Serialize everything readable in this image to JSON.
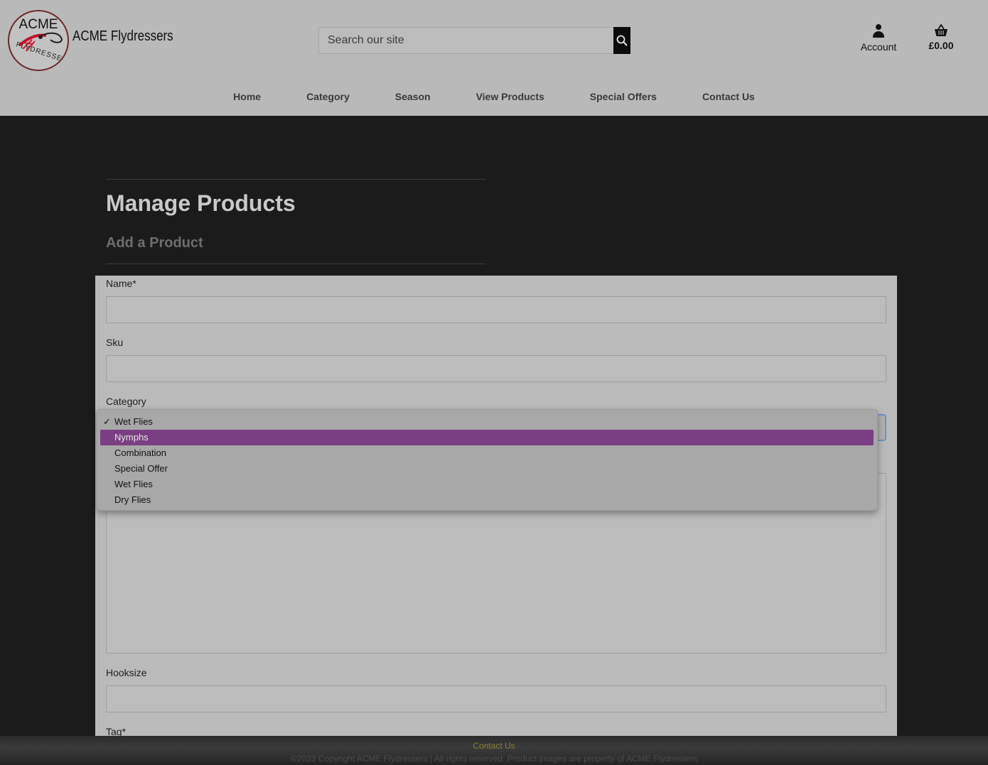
{
  "brand": {
    "logo_top": "ACME",
    "logo_bottom": "FLYDRESSERS",
    "name": "ACME Flydressers"
  },
  "search": {
    "placeholder": "Search our site"
  },
  "account": {
    "label": "Account"
  },
  "basket": {
    "total": "£0.00"
  },
  "nav": {
    "items": [
      "Home",
      "Category",
      "Season",
      "View Products",
      "Special Offers",
      "Contact Us"
    ]
  },
  "page": {
    "title": "Manage Products",
    "subtitle": "Add a Product"
  },
  "form": {
    "name_label": "Name*",
    "sku_label": "Sku",
    "category_label": "Category",
    "hooksize_label": "Hooksize",
    "tag_label": "Tag*"
  },
  "category_dropdown": {
    "checked_option": "Wet Flies",
    "highlighted_option": "Nymphs",
    "options": [
      "Wet Flies",
      "Nymphs",
      "Combination",
      "Special Offer",
      "Wet Flies",
      "Dry Flies"
    ],
    "highlight_color": "#7a3e82"
  },
  "footer": {
    "link": "Contact Us",
    "copyright": "©2023 Copyright ACME Flydressers | All rights reserved. Product images are property of ACME Flydressers"
  }
}
